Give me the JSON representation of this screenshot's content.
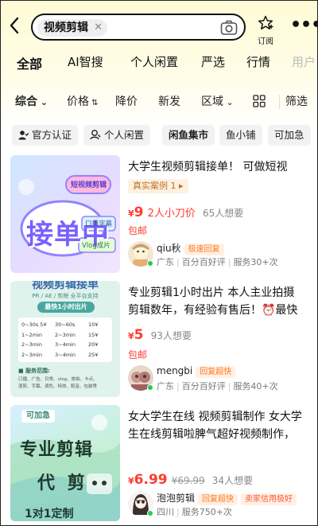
{
  "header": {
    "search_tag": "视频剪辑",
    "subscribe_label": "订阅",
    "more_label": "•••"
  },
  "tabs": [
    {
      "label": "全部"
    },
    {
      "label": "AI智搜"
    },
    {
      "label": "个人闲置"
    },
    {
      "label": "严选"
    },
    {
      "label": "行情"
    },
    {
      "label": "用户"
    }
  ],
  "filters": {
    "comprehensive": "综合",
    "price": "价格",
    "price_down": "降价",
    "new": "新发",
    "region": "区域",
    "filter": "筛选"
  },
  "chips": [
    {
      "label": "官方认证"
    },
    {
      "label": "个人闲置"
    },
    {
      "label": "闲鱼集市"
    },
    {
      "label": "鱼小铺"
    },
    {
      "label": "可加急"
    }
  ],
  "items": [
    {
      "title": "大学生视频剪辑接单！ 可做短视",
      "case_tag": "真实案例 1 ▸",
      "price": "9",
      "price_desc": "2人小刀价",
      "wants": "65人想要",
      "shipping": "包邮",
      "seller": {
        "name": "qiu秋",
        "badges": [
          "极速回复"
        ],
        "region": "广东",
        "rating": "百分百好评",
        "service": "服务30+次"
      },
      "thumb": {
        "title": "接单中",
        "subtitle": "短视频剪辑",
        "tag1": "口播字幕",
        "tag2": "Vlog成片"
      }
    },
    {
      "title_line1": "专业剪辑1小时出片 本人主业拍摄",
      "title_line2": "剪辑数年，有经验有售后！⏰最快",
      "price": "5",
      "wants": "93人想要",
      "shipping": "包邮",
      "seller": {
        "name": "mengbi",
        "badges": [
          "回复超快"
        ],
        "region": "广东",
        "rating": "百分百好评",
        "service": "服务40+次"
      },
      "thumb": {
        "top": "视频剪辑接单",
        "subtitle": "PR / AE / 剪映 全平台支持",
        "banner": "最快1小时出片",
        "rows": [
          [
            "0~30s 5¥",
            "30~60s",
            "10¥"
          ],
          [
            "1~2min",
            "2~3min",
            "15¥"
          ],
          [
            "2~3min",
            "3~4min",
            "20¥"
          ],
          [
            "2~3min",
            "3~4min",
            "25¥"
          ]
        ],
        "section": "■ 服务范围:",
        "notes": [
          "口播、广告、日常、vlog、旅拍、卡点、",
          "混剪、字幕、调色、特效、配音、包装等"
        ]
      }
    },
    {
      "title_line1": "女大学生在线 视频剪辑制作 女大学",
      "title_line2": "生在线剪辑啦脾气超好视频制作，",
      "price": "6.99",
      "orig_price": "¥69.99",
      "wants": "34人想要",
      "seller": {
        "name": "泡泡剪辑",
        "badges": [
          "回复超快",
          "卖家信用极好"
        ],
        "region": "四川",
        "service": "服务750+次"
      },
      "thumb": {
        "tag": "可加急",
        "line1": "专业剪辑",
        "line2": "代 剪",
        "line3": "1对1定制"
      }
    }
  ],
  "colors": {
    "accent_yellow": "#ffe600",
    "price_red": "#ff3b30",
    "badge_orange": "#ff7a1a"
  }
}
